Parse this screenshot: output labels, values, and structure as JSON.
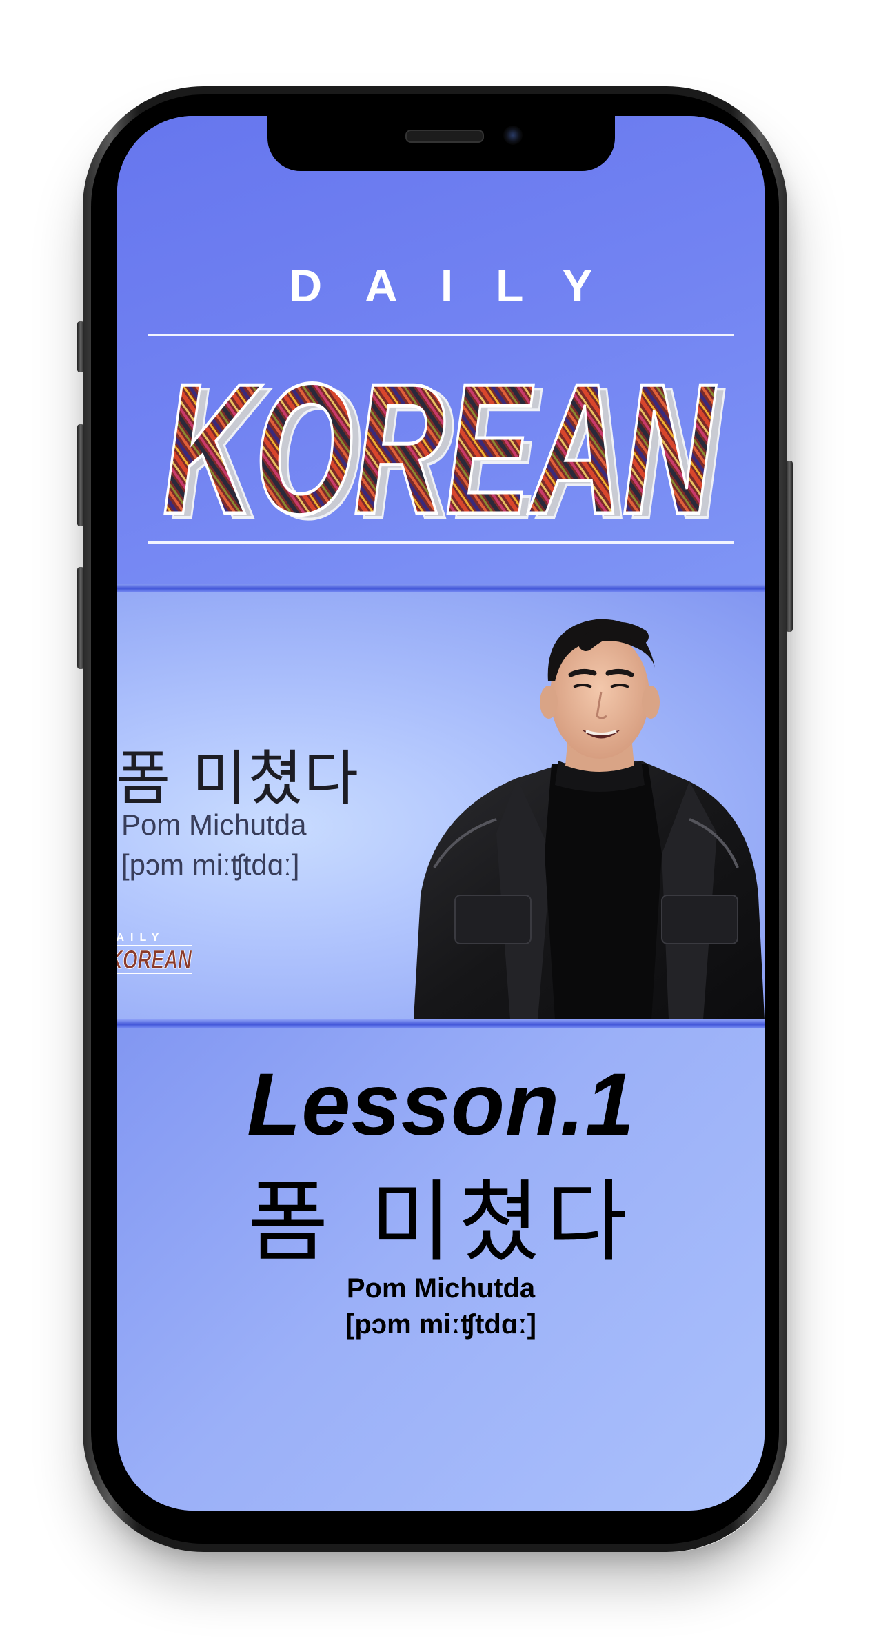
{
  "header": {
    "daily_label": "DAILY",
    "brand_title": "KOREAN"
  },
  "video": {
    "phrase_korean": "폼 미쳤다",
    "phrase_romanized": "Pom Michutda",
    "phrase_ipa": "[pɔm miːʧtdɑː]",
    "mini_logo_daily": "AILY",
    "mini_logo_brand": "KOREAN"
  },
  "lesson": {
    "title": "Lesson.1",
    "phrase_korean": "폼 미쳤다",
    "phrase_romanized": "Pom Michutda",
    "phrase_ipa": "[pɔm miːʧtdɑː]"
  },
  "colors": {
    "header_bg": "#6f82f1",
    "lesson_bg": "#9bb0f8",
    "divider": "#4357d8"
  }
}
